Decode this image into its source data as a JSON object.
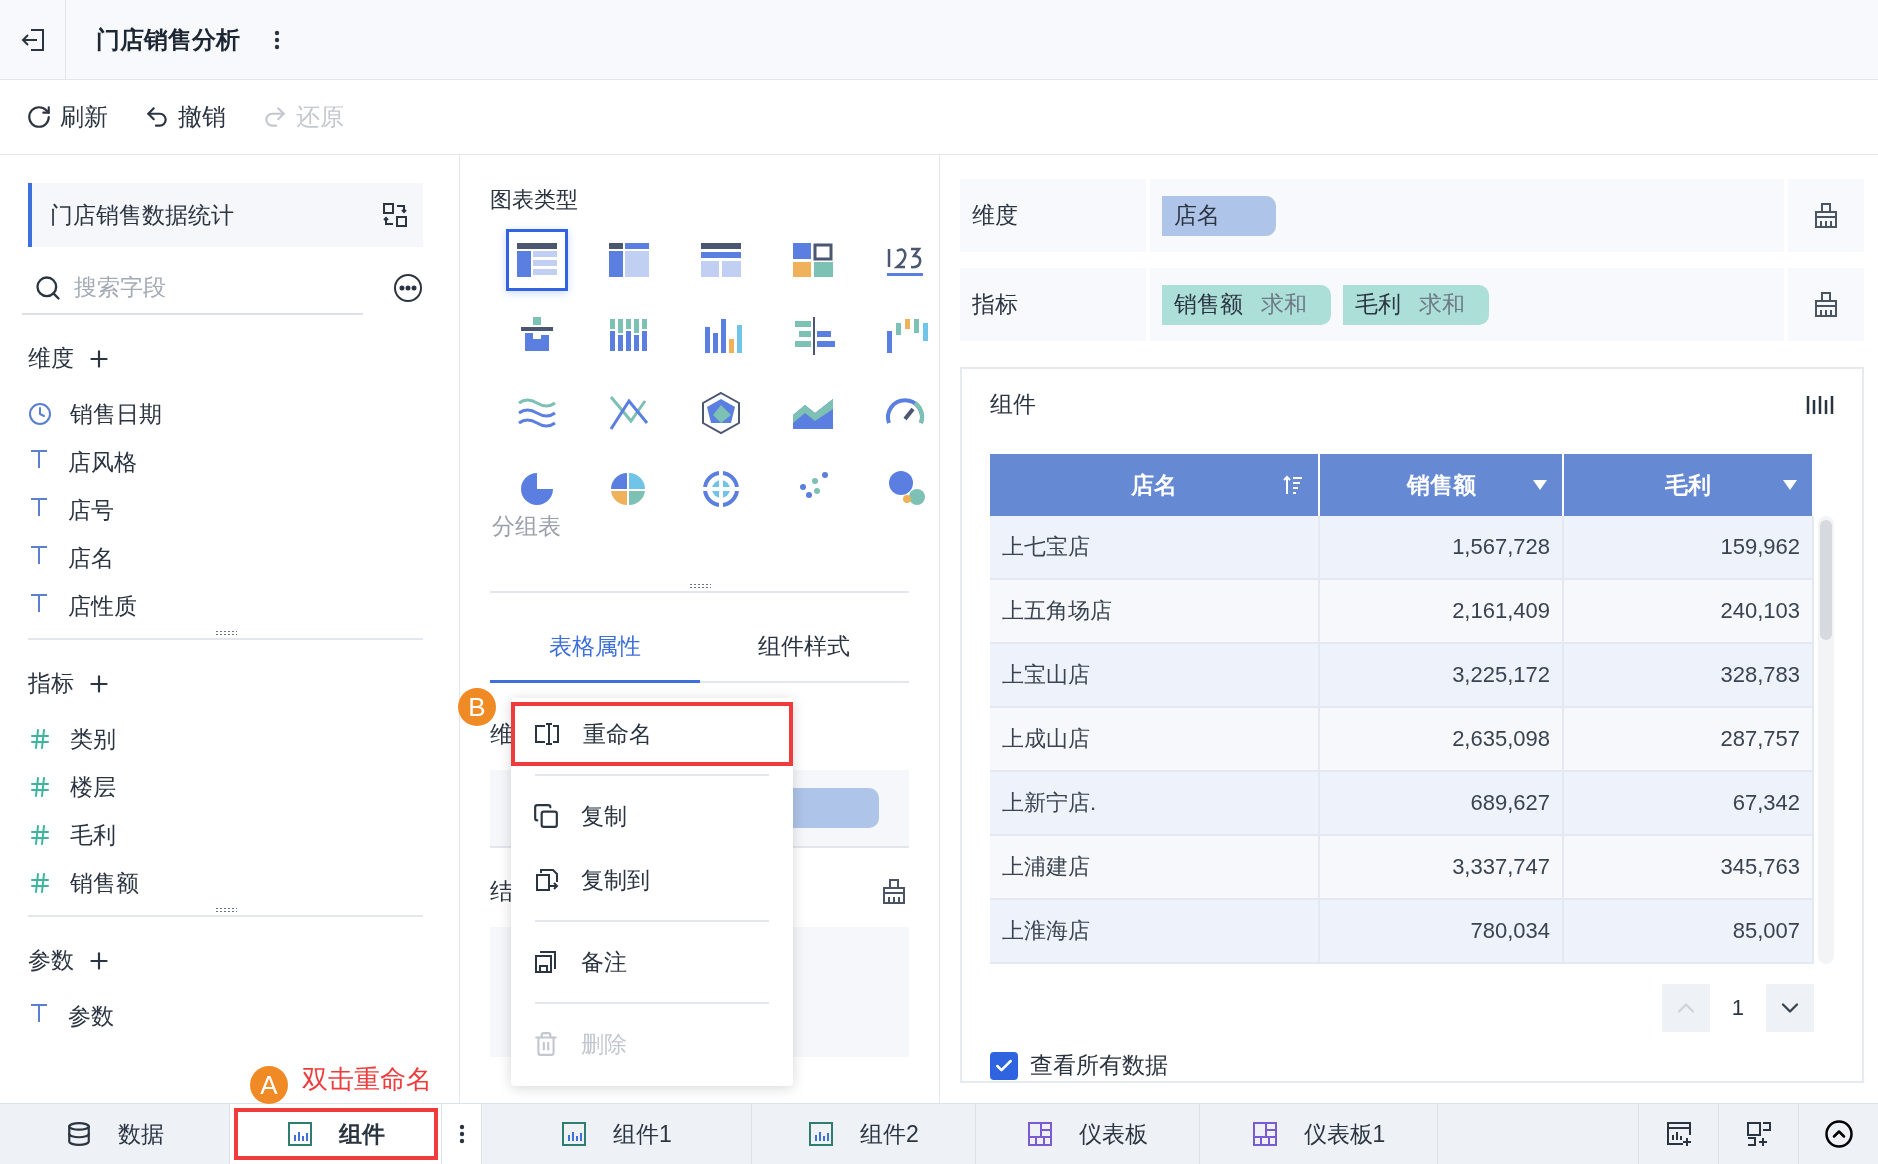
{
  "header": {
    "title": "门店销售分析"
  },
  "toolbar": [
    {
      "label": "刷新",
      "disabled": false
    },
    {
      "label": "撤销",
      "disabled": false
    },
    {
      "label": "还原",
      "disabled": true
    }
  ],
  "left_panel": {
    "dataset": "门店销售数据统计",
    "search": {
      "placeholder": "搜索字段"
    },
    "sections": [
      {
        "title": "维度",
        "fields": [
          {
            "name": "销售日期",
            "kind": "date"
          },
          {
            "name": "店风格",
            "kind": "text"
          },
          {
            "name": "店号",
            "kind": "text"
          },
          {
            "name": "店名",
            "kind": "text"
          },
          {
            "name": "店性质",
            "kind": "text"
          }
        ]
      },
      {
        "title": "指标",
        "fields": [
          {
            "name": "类别",
            "kind": "number"
          },
          {
            "name": "楼层",
            "kind": "number"
          },
          {
            "name": "毛利",
            "kind": "number"
          },
          {
            "name": "销售额",
            "kind": "number"
          }
        ]
      },
      {
        "title": "参数",
        "fields": [
          {
            "name": "参数",
            "kind": "text"
          }
        ]
      }
    ]
  },
  "middle_panel": {
    "title": "图表类型",
    "chart_types": [
      {
        "selected": true
      },
      {
        "selected": false
      },
      {
        "selected": false
      },
      {
        "selected": false
      },
      {
        "selected": false
      },
      {
        "selected": false
      },
      {
        "selected": false
      },
      {
        "selected": false
      },
      {
        "selected": false
      },
      {
        "selected": false
      },
      {
        "selected": false
      },
      {
        "selected": false
      },
      {
        "selected": false
      },
      {
        "selected": false
      },
      {
        "selected": false
      },
      {
        "selected": false
      },
      {
        "selected": false
      },
      {
        "selected": false
      },
      {
        "selected": false
      },
      {
        "selected": false
      }
    ],
    "tooltip": "分组表",
    "tabs": [
      {
        "label": "表格属性",
        "selected": true
      },
      {
        "label": "组件样式",
        "selected": false
      }
    ],
    "section_labels": [
      "维",
      "结"
    ]
  },
  "context_menu": {
    "groups": [
      [
        {
          "label": "重命名",
          "disabled": false,
          "highlighted": true
        }
      ],
      [
        {
          "label": "复制",
          "disabled": false,
          "highlighted": false
        },
        {
          "label": "复制到",
          "disabled": false,
          "highlighted": false
        }
      ],
      [
        {
          "label": "备注",
          "disabled": false,
          "highlighted": false
        }
      ],
      [
        {
          "label": "删除",
          "disabled": true,
          "highlighted": false
        }
      ]
    ]
  },
  "right_panel": {
    "shelves": [
      {
        "label": "维度",
        "chips": [
          {
            "name": "店名",
            "kind": "dimension"
          }
        ]
      },
      {
        "label": "指标",
        "chips": [
          {
            "name": "销售额",
            "aggregation": "求和",
            "kind": "measure"
          },
          {
            "name": "毛利",
            "aggregation": "求和",
            "kind": "measure"
          }
        ]
      }
    ],
    "widget": {
      "title": "组件",
      "columns": [
        {
          "label": "店名",
          "kind": "sort"
        },
        {
          "label": "销售额",
          "kind": "menu"
        },
        {
          "label": "毛利",
          "kind": "menu"
        }
      ],
      "rows": [
        [
          "上七宝店",
          "1,567,728",
          "159,962"
        ],
        [
          "上五角场店",
          "2,161,409",
          "240,103"
        ],
        [
          "上宝山店",
          "3,225,172",
          "328,783"
        ],
        [
          "上成山店",
          "2,635,098",
          "287,757"
        ],
        [
          "上新宁店.",
          "689,627",
          "67,342"
        ],
        [
          "上浦建店",
          "3,337,747",
          "345,763"
        ],
        [
          "上淮海店",
          "780,034",
          "85,007"
        ]
      ],
      "pager": {
        "page": "1",
        "prev_disabled": true,
        "next_disabled": false
      },
      "show_all": {
        "label": "查看所有数据",
        "checked": true
      }
    }
  },
  "bottom_tabs": [
    {
      "label": "数据",
      "kind": "data",
      "selected": false,
      "highlighted": false
    },
    {
      "label": "组件",
      "kind": "widget",
      "selected": true,
      "highlighted": true
    },
    {
      "label": "组件1",
      "kind": "widget",
      "selected": false,
      "highlighted": false
    },
    {
      "label": "组件2",
      "kind": "widget",
      "selected": false,
      "highlighted": false
    },
    {
      "label": "仪表板",
      "kind": "dashboard",
      "selected": false,
      "highlighted": false
    },
    {
      "label": "仪表板1",
      "kind": "dashboard",
      "selected": false,
      "highlighted": false
    }
  ],
  "annotations": [
    {
      "badge": "A",
      "text": "双击重命名"
    },
    {
      "badge": "B"
    }
  ]
}
